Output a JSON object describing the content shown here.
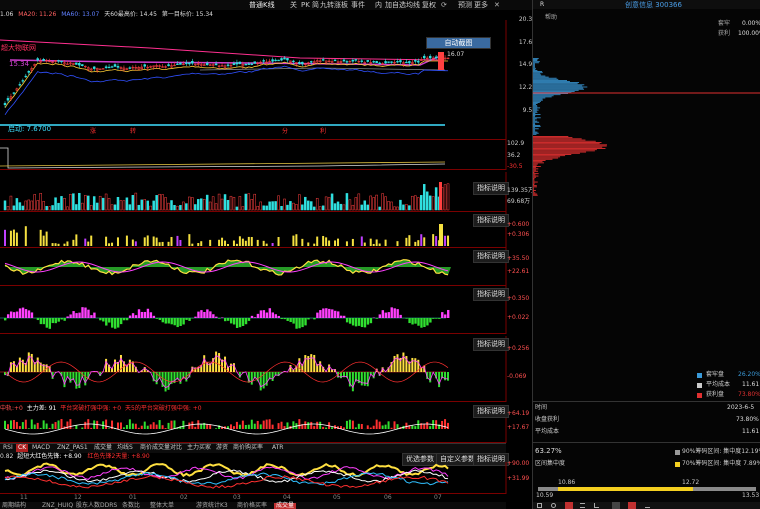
{
  "toolbar": {
    "chart_type": "普通K线",
    "items": [
      "关",
      "PK",
      "简",
      "九转",
      "涨板",
      "事件",
      "内",
      "加自选",
      "均线",
      "复权",
      "预测",
      "更多"
    ],
    "close_icon": "close-icon",
    "refresh_icon": "refresh-icon"
  },
  "main_chart": {
    "indicator_values": [
      "1.06",
      "MA20: 11.26",
      "MA60: 13.07",
      "天60最高价: 14.45",
      "第一目标价: 15.34"
    ],
    "y_ticks": [
      "20.34",
      "17.67",
      "14.94",
      "12.27",
      "9.54"
    ],
    "high_label": "16.07",
    "target_label": "15.34",
    "support_label": "启动: 7.6700",
    "zone_label": "超大物联网",
    "auto_zoom_button": "自动截图",
    "markers": [
      "涨",
      "转",
      "分",
      "利"
    ]
  },
  "panel2": {
    "y_ticks": [
      "102.9",
      "36.2",
      "-30.5"
    ]
  },
  "volume_panel": {
    "explain": "指标说明",
    "y_ticks": [
      "139.35万",
      "69.68万"
    ]
  },
  "panel_a": {
    "explain": "指标说明",
    "y_ticks": [
      "+0.600",
      "+0.306"
    ]
  },
  "panel_b": {
    "explain": "指标说明",
    "y_ticks": [
      "+35.50",
      "+22.61"
    ]
  },
  "panel_c": {
    "explain": "指标说明",
    "y_ticks": [
      "+0.350",
      "+0.022"
    ]
  },
  "panel_d": {
    "explain": "指标说明",
    "y_ticks": [
      "+0.256",
      "-0.069"
    ]
  },
  "panel_e": {
    "legend": [
      "中轨:+0",
      "主力差: 91",
      "平台突破打强中强: +0",
      "天5的平台突破打强中强: +0"
    ],
    "explain": "指标说明",
    "y_ticks": [
      "+64.19",
      "+17.67"
    ]
  },
  "indicator_tabs": [
    "RSI",
    "CK",
    "MACD",
    "ZNZ_PAS1",
    "成交量",
    "均线S",
    "商价成交量对比",
    "主力买家",
    "游资",
    "商价购买率",
    "ATR"
  ],
  "bottom_panel": {
    "legend": [
      "0.82",
      "超短大红色先锋: +8.90",
      "红色先锋2天量: +8.90"
    ],
    "opt_button": "优选参数",
    "custom_button": "自定义参数",
    "explain": "指标说明",
    "y_ticks": [
      "+90.00",
      "+31.99"
    ]
  },
  "x_ticks": [
    "11",
    "12",
    "01",
    "02",
    "03",
    "04",
    "05",
    "06",
    "07"
  ],
  "bottom_tabs": [
    "周期结构",
    "ZNZ_HUIQ",
    "股东人数DDRS",
    "条数比",
    "整体大单",
    "游资统计K3",
    "商价格买率",
    "成交量"
  ],
  "right_panel": {
    "header_left": "R",
    "title": "创意信息 300366",
    "subtitle": "帮助",
    "rows_top": [
      {
        "label": "套牢",
        "value": "0.00%"
      },
      {
        "label": "获利",
        "value": "100.00%"
      }
    ],
    "legend": [
      {
        "label": "套牢盘",
        "value": "26.20%",
        "color": "#3a9ad9"
      },
      {
        "label": "平均成本",
        "value": "11.61",
        "color": "#cccccc"
      },
      {
        "label": "获利盘",
        "value": "73.80%",
        "color": "#e03030"
      }
    ],
    "stats": [
      {
        "label": "时间",
        "value": "2023-6-5"
      },
      {
        "label": "收盘获利",
        "value": "73.80%"
      },
      {
        "label": "平均成本",
        "value": "11.61"
      }
    ],
    "concentration": {
      "percent": "63.27%",
      "label": "区间集中度",
      "row90": "90%筹码区间: 集中度12.19%",
      "row70": "70%筹码区间: 集中度 7.89%",
      "c90": "#9a9a9a",
      "c70": "#f5d020"
    },
    "range_bar": {
      "low": "10.59",
      "mid_low": "10.86",
      "mid_high": "12.72",
      "high": "13.53"
    },
    "bottom_icons": [
      "grid-icon",
      "settings-icon",
      "chip-icon",
      "list-icon",
      "chart-icon",
      "window-icon",
      "down-icon",
      "minimize-icon"
    ]
  }
}
